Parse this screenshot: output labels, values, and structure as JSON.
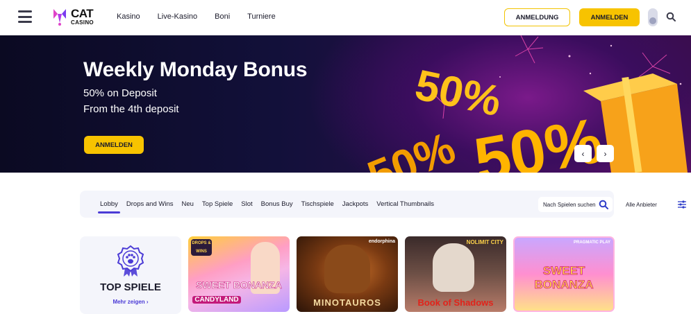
{
  "header": {
    "logo_top": "CAT",
    "logo_bottom": "CASINO",
    "nav": [
      "Kasino",
      "Live-Kasino",
      "Boni",
      "Turniere"
    ],
    "login_label": "ANMELDUNG",
    "register_label": "ANMELDEN"
  },
  "hero": {
    "title": "Weekly Monday Bonus",
    "subtitle_1": "50% on Deposit",
    "subtitle_2": "From the 4th deposit",
    "cta_label": "ANMELDEN",
    "art_text_1": "50%",
    "art_text_2": "50%",
    "art_text_3": "50%",
    "prev_icon": "‹",
    "next_icon": "›"
  },
  "tabs": {
    "items": [
      "Lobby",
      "Drops and Wins",
      "Neu",
      "Top Spiele",
      "Slot",
      "Bonus Buy",
      "Tischspiele",
      "Jackpots",
      "Vertical Thumbnails"
    ],
    "active_index": 0,
    "search_label": "Nach Spielen suchen",
    "provider_label": "Alle Anbieter"
  },
  "games": {
    "top_card_title": "TOP SPIELE",
    "top_card_link": "Mehr zeigen",
    "tiles": [
      {
        "title": "SWEET BONANZA",
        "subtitle": "CANDYLAND",
        "badge": "DROPS & WINS"
      },
      {
        "title": "MINOTAUROS",
        "badge": "endorphina"
      },
      {
        "title": "Book of Shadows",
        "badge": "NOLIMIT CITY"
      },
      {
        "title": "SWEET BONANZA",
        "badge": "PRAGMATIC PLAY"
      }
    ]
  },
  "colors": {
    "accent_yellow": "#f7c300",
    "accent_purple": "#4b3bd6",
    "hero_bg": "#12103a"
  }
}
